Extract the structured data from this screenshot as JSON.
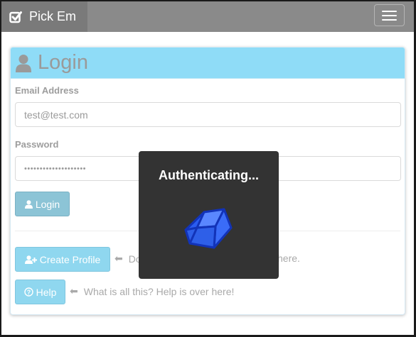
{
  "navbar": {
    "brand": "Pick Em",
    "brand_icon": "check-square-icon",
    "menu_icon": "hamburger-menu-icon"
  },
  "panel": {
    "heading": "Login",
    "heading_icon": "user-icon",
    "email": {
      "label": "Email Address",
      "value": "test@test.com"
    },
    "password": {
      "label": "Password",
      "value": "••••••••••••••••••••"
    },
    "login_button": "Login",
    "create_profile_button": "Create Profile",
    "create_profile_hint_left": "Do",
    "create_profile_hint_right": "here.",
    "help_button": "Help",
    "help_hint": "What is all this? Help is over here!"
  },
  "modal": {
    "title": "Authenticating...",
    "icon": "spinning-cube-icon"
  },
  "colors": {
    "navbar": "#8a8a8a",
    "panel_heading": "#8fdcf7",
    "button": "#8fd7ef",
    "modal_bg": "#333333",
    "cube": "#1a4fd8"
  }
}
